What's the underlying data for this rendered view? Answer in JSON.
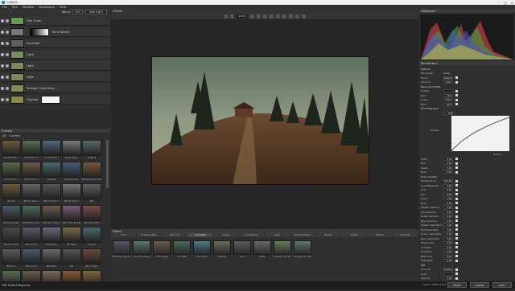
{
  "window": {
    "title": "Cyberia",
    "min": "–",
    "max": "□",
    "close": "×"
  },
  "menu": [
    "File",
    "Edit",
    "Window",
    "Workspace",
    "Help"
  ],
  "layers": {
    "header": {
      "blend": "Blend",
      "amount": "100",
      "mode": "Soft Light"
    },
    "rows": [
      {
        "name": "Film Grain",
        "color": "#6a9a50"
      },
      {
        "name": "",
        "mask_label": "HD Gradient",
        "color": "#777"
      },
      {
        "name": "Backlight",
        "color": "#606060"
      },
      {
        "name": "Light",
        "color": "#7a8a60"
      },
      {
        "name": "Light",
        "color": "#7a8a60"
      },
      {
        "name": "Light",
        "color": "#7a8a60"
      },
      {
        "name": "Vintage Color Wrap",
        "color": "#8a8a50"
      },
      {
        "name": "Original",
        "mask_label": "",
        "color": "#8a8a40"
      }
    ]
  },
  "presets": {
    "title": "Presets",
    "tab_all": "All",
    "tab_current": "Current",
    "items": [
      {
        "label": "Architecture 1",
        "c": "#6b5a3e"
      },
      {
        "label": "Architecture 2",
        "c": "#5a6b58"
      },
      {
        "label": "Architecture 3",
        "c": "#4f6b7a"
      },
      {
        "label": "Bright Scene",
        "c": "#7a7a7a"
      },
      {
        "label": "Bright 3",
        "c": "#5b6a6a"
      },
      {
        "label": "Autochrome 1",
        "c": "#5a6a4a"
      },
      {
        "label": "Autochrome 2",
        "c": "#6a5a4a"
      },
      {
        "label": "Blobbed",
        "c": "#4a6a6a"
      },
      {
        "label": "Blade Runner",
        "c": "#4a5a7a"
      },
      {
        "label": "Blade Runner 2049",
        "c": "#7a5a3a"
      },
      {
        "label": "Bronze",
        "c": "#6a5a3a"
      },
      {
        "label": "BW Art Style 1",
        "c": "#666"
      },
      {
        "label": "BW Art Style 2",
        "c": "#555"
      },
      {
        "label": "BW Art Style 3",
        "c": "#777"
      },
      {
        "label": "BW",
        "c": "#606060"
      },
      {
        "label": "BW Faded Blue",
        "c": "#4a5a6a"
      },
      {
        "label": "BW Faded Green",
        "c": "#4a6a5a"
      },
      {
        "label": "BW Faded Sepia",
        "c": "#6a5a4a"
      },
      {
        "label": "BW Faded Purple",
        "c": "#7a5a7a"
      },
      {
        "label": "BW Faded Red",
        "c": "#7a4a4a"
      },
      {
        "label": "BW Film Grain",
        "c": "#4a4a4a"
      },
      {
        "label": "BW Gloomy",
        "c": "#5a5a6a"
      },
      {
        "label": "BW Toning",
        "c": "#6a6a7a"
      },
      {
        "label": "BW Sepia",
        "c": "#7a6a4a"
      },
      {
        "label": "Cinema",
        "c": "#4a6a6a"
      },
      {
        "label": "BW Lo Fi",
        "c": "#5a5a5a"
      },
      {
        "label": "BW Lo Cool",
        "c": "#4a5a6a"
      },
      {
        "label": "BW Matte",
        "c": "#6a6a6a"
      },
      {
        "label": "BW",
        "c": "#555"
      },
      {
        "label": "Burn Edges",
        "c": "#6a4a3a"
      },
      {
        "label": "BW Cool Warm",
        "c": "#5a6a5a"
      },
      {
        "label": "BW Low Warm",
        "c": "#6a5a4a"
      },
      {
        "label": "BW Warm",
        "c": "#7a6a5a"
      },
      {
        "label": "Cartoon",
        "c": "#8a5a3a"
      },
      {
        "label": "Cartoon Highlight",
        "c": "#7a6a3a"
      }
    ]
  },
  "viewer": {
    "title": "Viewer",
    "zoom": "100%"
  },
  "filters": {
    "title": "Filters",
    "tabs": [
      "Color",
      "Diffusion/Blur",
      "Film Lab",
      "Grain/Dirt",
      "Image",
      "Lens/Distort",
      "Light",
      "Particle Engine",
      "Render",
      "Stylize",
      "Texture",
      "Favorites"
    ],
    "active_tab": "Grain/Dirt",
    "items": [
      {
        "label": "BW Bleach Bypass",
        "c": "#556"
      },
      {
        "label": "Cross Processing",
        "c": "#5a7a6a"
      },
      {
        "label": "CTM Vintage",
        "c": "#6a5a4a"
      },
      {
        "label": "ColorWell",
        "c": "#4a6a5a"
      },
      {
        "label": "Film Stock",
        "c": "#4a7a8a"
      },
      {
        "label": "Flashing",
        "c": "#6a6a5a"
      },
      {
        "label": "Grain",
        "c": "#5a5a5a"
      },
      {
        "label": "Matte",
        "c": "#6a6a6a"
      },
      {
        "label": "Vintage Color Wrap",
        "c": "#6a7a5a"
      },
      {
        "label": "Vintage Color Wrap",
        "c": "#5a7a6a"
      }
    ]
  },
  "histogram": {
    "title": "Histogram"
  },
  "parameters": {
    "title": "Parameters",
    "section": "Options",
    "head_param": "Parameter",
    "head_value": "Value",
    "rows": [
      {
        "l": "Blend",
        "v": "Default"
      },
      {
        "l": "Amount",
        "v": "100.0"
      }
    ],
    "black_and_white": "Black and White",
    "bw_rows": [
      {
        "l": "Enable",
        "v": ""
      },
      {
        "l": "Red",
        "v": "-40.0"
      },
      {
        "l": "Green",
        "v": "100.0"
      },
      {
        "l": "Blue",
        "v": "-60.0"
      }
    ],
    "film_response": "Film Response",
    "film_type": "RGB",
    "curves_label": "Curves",
    "curve_preset": "Default",
    "shift_rows": [
      {
        "l": "Shift",
        "v": "0.00"
      },
      {
        "l": "Red",
        "v": "0.00"
      },
      {
        "l": "Green",
        "v": "0.00"
      },
      {
        "l": "Blue",
        "v": "0.00"
      }
    ],
    "color_correct": "Color Correct",
    "cc_rows": [
      {
        "l": "Temperature",
        "v": "100.00"
      },
      {
        "l": "Cyan/Magenta",
        "v": "0.00"
      },
      {
        "l": "Tint",
        "v": "0.00"
      },
      {
        "l": "Red",
        "v": "0.00"
      },
      {
        "l": "Green",
        "v": "0.00"
      },
      {
        "l": "Blue",
        "v": "0.00"
      },
      {
        "l": "Master Gamma",
        "v": "0.00"
      },
      {
        "l": "Red Gamma",
        "v": "0.00"
      },
      {
        "l": "Green Gamma",
        "v": "0.00"
      },
      {
        "l": "Blue Gamma",
        "v": "0.00"
      },
      {
        "l": "Master Saturation",
        "v": "0.00"
      },
      {
        "l": "Red Saturation",
        "v": "0.00"
      },
      {
        "l": "Green Saturation",
        "v": "0.00"
      },
      {
        "l": "Blue Saturation",
        "v": "0.00"
      },
      {
        "l": "Brightness",
        "v": "0.00"
      },
      {
        "l": "Contrast",
        "v": "0.00"
      },
      {
        "l": "Shadows",
        "v": "0.00"
      },
      {
        "l": "Midtones",
        "v": "0.00"
      },
      {
        "l": "Highlights",
        "v": "0.00"
      }
    ],
    "mix": "Mix",
    "mix_rows": [
      {
        "l": "Amount",
        "v": "Custom"
      },
      {
        "l": "Color",
        "v": ""
      },
      {
        "l": "Opacity",
        "v": "0.00"
      },
      {
        "l": "Highlights",
        "v": "0.00"
      }
    ]
  },
  "status": {
    "text": "BW Faded Magenta",
    "coords": "1920 x 1080 (8 bit)",
    "reset": "RESET",
    "cancel": "CANCEL",
    "apply": "APPLY"
  }
}
